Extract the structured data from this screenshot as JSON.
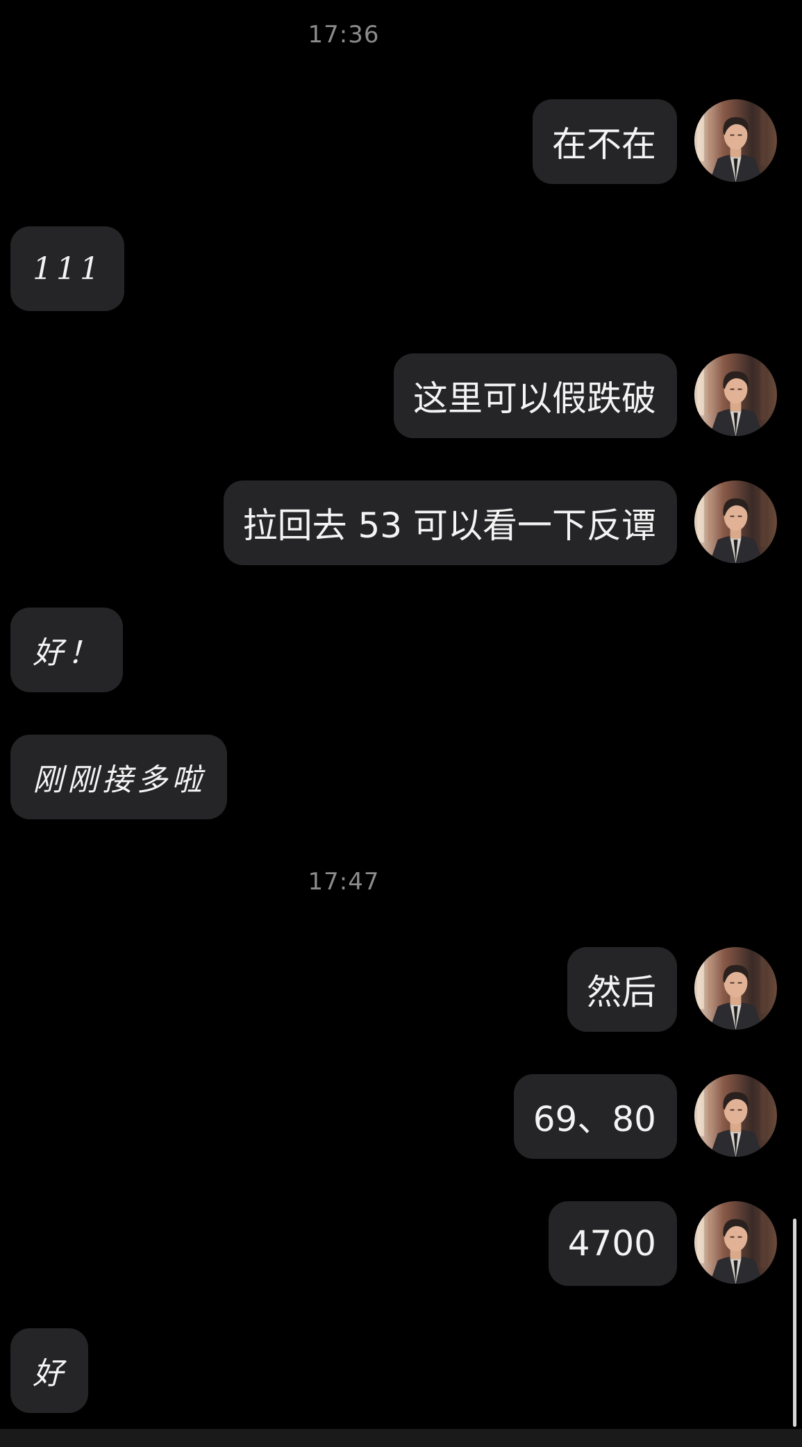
{
  "chat": {
    "timestamps": [
      "17:36",
      "17:47"
    ],
    "messages": [
      {
        "direction": "out",
        "text": "在不在"
      },
      {
        "direction": "in",
        "text": "111"
      },
      {
        "direction": "out",
        "text": "这里可以假跌破"
      },
      {
        "direction": "out",
        "text": "拉回去 53 可以看一下反谭"
      },
      {
        "direction": "in",
        "text": "好！"
      },
      {
        "direction": "in",
        "text": "刚刚接多啦"
      },
      {
        "direction": "out",
        "text": "然后"
      },
      {
        "direction": "out",
        "text": "69、80"
      },
      {
        "direction": "out",
        "text": "4700"
      },
      {
        "direction": "in",
        "text": "好"
      }
    ]
  },
  "colors": {
    "background": "#000000",
    "bubble": "#252527",
    "timestamp": "#8c8c8c"
  },
  "icons": {
    "avatar": "man-in-suit-portrait-avatar"
  }
}
